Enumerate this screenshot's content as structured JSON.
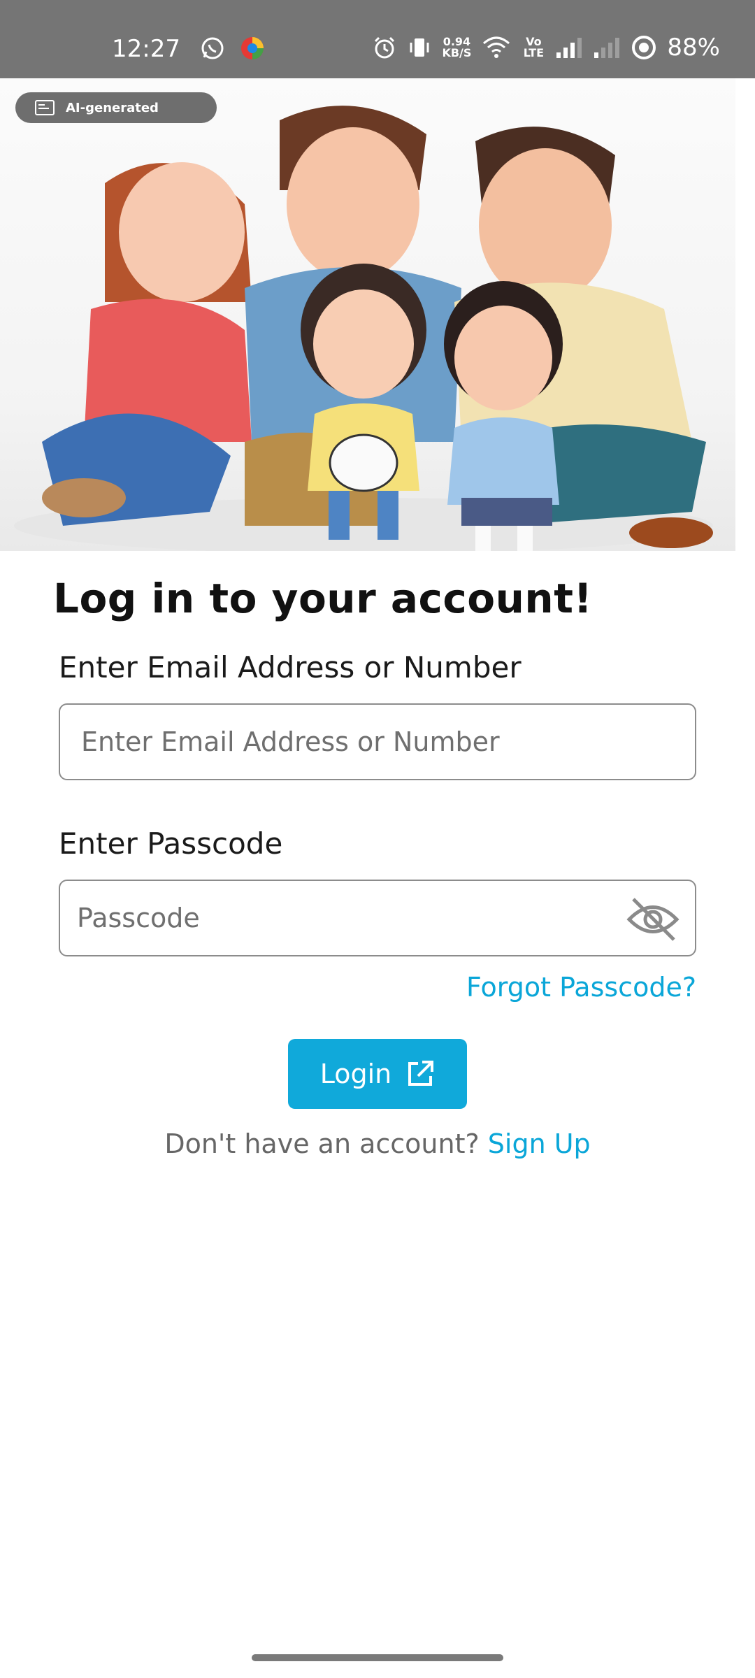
{
  "status_bar": {
    "time": "12:27",
    "net_speed_value": "0.94",
    "net_speed_unit": "KB/S",
    "volte_label": "Vo LTE",
    "battery": "88%",
    "icons": [
      "whatsapp-icon",
      "browser-icon",
      "alarm-icon",
      "vibrate-icon",
      "wifi-icon",
      "signal-icon",
      "signal-2-icon",
      "battery-saver-icon"
    ]
  },
  "hero": {
    "badge_label": "AI-generated",
    "image_name": "family-illustration"
  },
  "login": {
    "title": "Log in to your account!",
    "email_label": "Enter Email Address or Number",
    "email_placeholder": "Enter Email Address or Number",
    "email_value": "",
    "passcode_label": "Enter Passcode",
    "passcode_placeholder": "Passcode",
    "passcode_value": "",
    "forgot_label": "Forgot Passcode?",
    "button_label": "Login",
    "no_account_text": "Don't have an account?",
    "signup_label": "Sign Up"
  },
  "colors": {
    "accent": "#10a9da",
    "link": "#0aa6d8",
    "status_bar": "#757575"
  }
}
